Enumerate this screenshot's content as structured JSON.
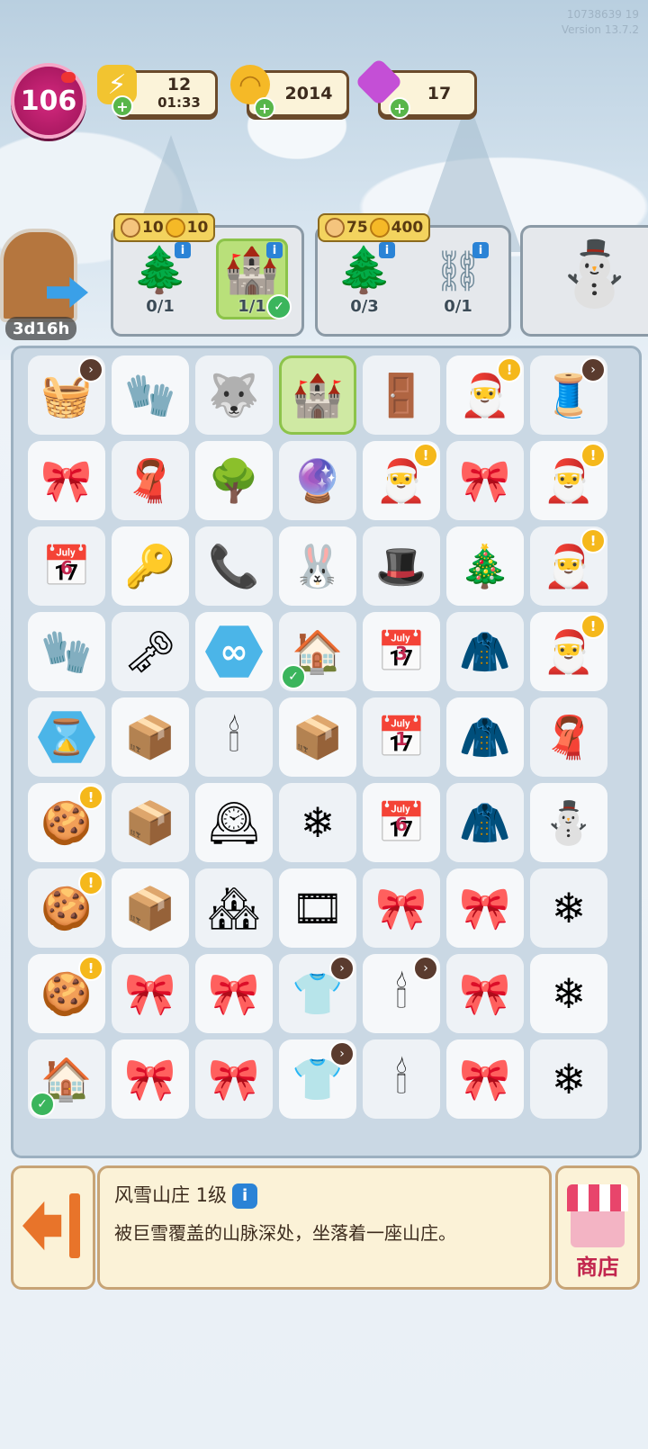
{
  "top_info": {
    "id": "10738639 19",
    "version": "Version 13.7.2"
  },
  "level": "106",
  "energy": {
    "value": "12",
    "timer": "01:33"
  },
  "coins": "2014",
  "gems": "17",
  "portal": {
    "timer": "3d16h"
  },
  "orders": [
    {
      "reward_cookies": "10",
      "reward_coins": "10",
      "items": [
        {
          "name": "snowy-pine",
          "count": "0/1",
          "glyph": "🌲"
        },
        {
          "name": "snow-manor",
          "count": "1/1",
          "glyph": "🏰",
          "done": true
        }
      ]
    },
    {
      "reward_cookies": "75",
      "reward_coins": "400",
      "items": [
        {
          "name": "snowy-pine",
          "count": "0/3",
          "glyph": "🌲"
        },
        {
          "name": "handcuffs",
          "count": "0/1",
          "glyph": "⛓"
        }
      ]
    }
  ],
  "board": [
    [
      {
        "g": "🧺",
        "b": "arrow"
      },
      {
        "g": "🧤"
      },
      {
        "g": "🐺"
      },
      {
        "g": "🏰",
        "sel": true
      },
      {
        "g": "🚪"
      },
      {
        "g": "🎅",
        "b": "bang"
      },
      {
        "g": "🧵",
        "b": "arrow"
      }
    ],
    [
      {
        "g": "🎀"
      },
      {
        "g": "🧣"
      },
      {
        "g": "🌳"
      },
      {
        "g": "🔮"
      },
      {
        "g": "🎅",
        "b": "bang"
      },
      {
        "g": "🎀"
      },
      {
        "g": "🎅",
        "b": "bang"
      }
    ],
    [
      {
        "g": "📅",
        "t": "6"
      },
      {
        "g": "🔑"
      },
      {
        "g": "📞"
      },
      {
        "g": "🐰"
      },
      {
        "g": "🎩"
      },
      {
        "g": "🎄"
      },
      {
        "g": "🎅",
        "b": "bang"
      }
    ],
    [
      {
        "g": "🧤"
      },
      {
        "g": "🗝"
      },
      {
        "g": "∞",
        "hex": true
      },
      {
        "g": "🏠",
        "b": "check"
      },
      {
        "g": "📅",
        "t": "3"
      },
      {
        "g": "🧥"
      },
      {
        "g": "🎅",
        "b": "bang"
      }
    ],
    [
      {
        "g": "⌛",
        "hex": true
      },
      {
        "g": "📦"
      },
      {
        "g": "🕯"
      },
      {
        "g": "📦"
      },
      {
        "g": "📅",
        "t": "1"
      },
      {
        "g": "🧥"
      },
      {
        "g": "🧣"
      }
    ],
    [
      {
        "g": "🍪",
        "b": "bang"
      },
      {
        "g": "📦"
      },
      {
        "g": "🕰"
      },
      {
        "g": "❄"
      },
      {
        "g": "📅",
        "t": "6"
      },
      {
        "g": "🧥"
      },
      {
        "g": "⛄"
      }
    ],
    [
      {
        "g": "🍪",
        "b": "bang"
      },
      {
        "g": "📦"
      },
      {
        "g": "🏘"
      },
      {
        "g": "🎞"
      },
      {
        "g": "🎀"
      },
      {
        "g": "🎀"
      },
      {
        "g": "❄"
      }
    ],
    [
      {
        "g": "🍪",
        "b": "bang"
      },
      {
        "g": "🎀"
      },
      {
        "g": "🎀"
      },
      {
        "g": "👕",
        "b": "arrow"
      },
      {
        "g": "🕯",
        "b": "arrow"
      },
      {
        "g": "🎀"
      },
      {
        "g": "❄"
      }
    ],
    [
      {
        "g": "🏠",
        "b": "check"
      },
      {
        "g": "🎀"
      },
      {
        "g": "🎀"
      },
      {
        "g": "👕",
        "b": "arrow"
      },
      {
        "g": "🕯"
      },
      {
        "g": "🎀"
      },
      {
        "g": "❄"
      }
    ]
  ],
  "detail": {
    "title": "风雪山庄 1级",
    "body": "被巨雪覆盖的山脉深处，坐落着一座山庄。"
  },
  "shop_label": "商店"
}
